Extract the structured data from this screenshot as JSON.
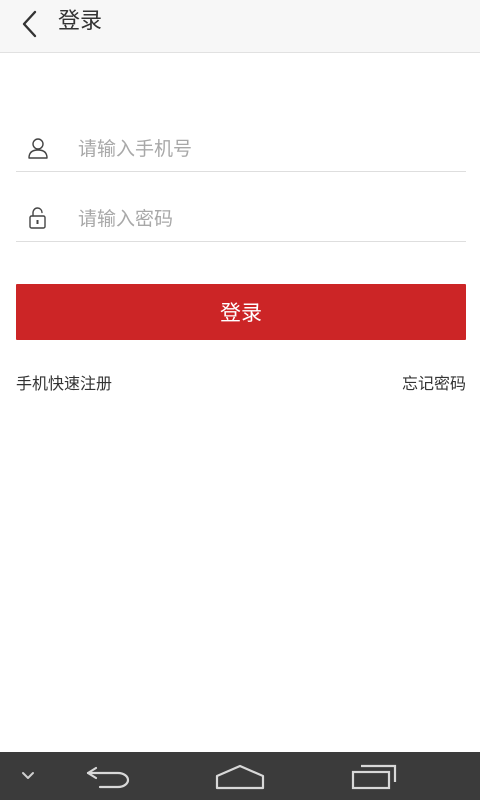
{
  "header": {
    "title": "登录",
    "back_icon": "chevron-left-icon"
  },
  "form": {
    "phone": {
      "placeholder": "请输入手机号",
      "value": "",
      "icon": "user-icon"
    },
    "password": {
      "placeholder": "请输入密码",
      "value": "",
      "icon": "unlock-icon"
    },
    "login_button": "登录"
  },
  "links": {
    "register": "手机快速注册",
    "forgot": "忘记密码"
  },
  "navbar": {
    "icons": [
      "chevron-down-icon",
      "back-arrow-icon",
      "home-icon",
      "recent-apps-icon"
    ]
  },
  "colors": {
    "accent": "#cc2526",
    "header_bg": "#f7f7f7",
    "navbar_bg": "#3b3b3b"
  }
}
